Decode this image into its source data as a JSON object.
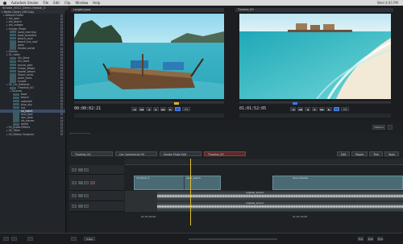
{
  "menubar": {
    "items": [
      "Autodesk Smoke",
      "File",
      "Edit",
      "Clip",
      "Window",
      "Help"
    ],
    "clock": "Wed 4:05 PM"
  },
  "window": {
    "title": "Smoke_2012_Demo_Hawaii_2"
  },
  "sidebar": {
    "header": "Media Library (Off Dup)",
    "items": [
      {
        "label": "Default Folder",
        "indent": 1,
        "kind": "folder"
      },
      {
        "label": "vid_spec",
        "indent": 2,
        "kind": "folder"
      },
      {
        "label": "vid_beach",
        "indent": 2,
        "kind": "folder"
      },
      {
        "label": "vid_collage",
        "indent": 2,
        "kind": "folder"
      },
      {
        "label": "Smoke_Photo",
        "indent": 2,
        "kind": "folder"
      },
      {
        "label": "sand_morning",
        "indent": 3,
        "kind": "clip"
      },
      {
        "label": "boat_shoreline",
        "indent": 3,
        "kind": "clip"
      },
      {
        "label": "beach_cove",
        "indent": 3,
        "kind": "clip"
      },
      {
        "label": "beach_hut_roof",
        "indent": 3,
        "kind": "clip"
      },
      {
        "label": "palm",
        "indent": 3,
        "kind": "clip"
      },
      {
        "label": "Smoke_aerial",
        "indent": 3,
        "kind": "clip"
      },
      {
        "label": "Scenes",
        "indent": 2,
        "kind": "folder"
      },
      {
        "label": "01_Hotel",
        "indent": 2,
        "kind": "folder"
      },
      {
        "label": "Sin_Desk",
        "indent": 3,
        "kind": "clip"
      },
      {
        "label": "Sin_Dock",
        "indent": 3,
        "kind": "clip"
      },
      {
        "label": "tunnel_side",
        "indent": 3,
        "kind": "clip"
      },
      {
        "label": "Ocean_Water",
        "indent": 3,
        "kind": "clip"
      },
      {
        "label": "hawaii_beach",
        "indent": 3,
        "kind": "clip"
      },
      {
        "label": "Shore_rocks",
        "indent": 3,
        "kind": "clip"
      },
      {
        "label": "palm_trees",
        "indent": 3,
        "kind": "clip"
      },
      {
        "label": "sunset",
        "indent": 3,
        "kind": "clip"
      },
      {
        "label": "02_Car_Editorial",
        "indent": 2,
        "kind": "folder"
      },
      {
        "label": "Timeline_VO",
        "indent": 3,
        "kind": "clip"
      },
      {
        "label": "Sources",
        "indent": 3,
        "kind": "folder"
      },
      {
        "label": "boat",
        "indent": 4,
        "kind": "clip"
      },
      {
        "label": "beach",
        "indent": 4,
        "kind": "clip"
      },
      {
        "label": "waterfall",
        "indent": 4,
        "kind": "clip"
      },
      {
        "label": "blue_sky",
        "indent": 4,
        "kind": "clip"
      },
      {
        "label": "hut",
        "indent": 4,
        "kind": "clip"
      },
      {
        "label": "vo_take3",
        "indent": 4,
        "kind": "clip",
        "selected": true
      },
      {
        "label": "mus_bed",
        "indent": 4,
        "kind": "clip"
      },
      {
        "label": "rain_dark",
        "indent": 4,
        "kind": "clip"
      },
      {
        "label": "sfx_waves",
        "indent": 4,
        "kind": "clip"
      },
      {
        "label": "aerial",
        "indent": 4,
        "kind": "clip"
      },
      {
        "label": "03_Audio Effects",
        "indent": 2,
        "kind": "folder"
      },
      {
        "label": "04_Titles",
        "indent": 2,
        "kind": "folder"
      },
      {
        "label": "05_Motion Graphics",
        "indent": 2,
        "kind": "folder"
      }
    ]
  },
  "viewers": {
    "left": {
      "tab": "Longtail_boat",
      "timecode": "00:00:02:21",
      "controls": [
        "|◀",
        "◀◀",
        "◀",
        "▶",
        "▶▶",
        "▶|"
      ],
      "zoom": "Fit"
    },
    "right": {
      "tab": "Timeline_VO",
      "timecode": "01:01:52:05",
      "controls": [
        "|◀",
        "◀◀",
        "◀",
        "▶",
        "▶▶",
        "▶|"
      ],
      "zoom": "Fit"
    },
    "options_label": "Options"
  },
  "timeline": {
    "mode_label": "Source",
    "mode2_label": "Record Mode",
    "sequence_tabs": [
      "Timeline_VO",
      "Car Commercial VO",
      "Smoke Photo Edit",
      "Timeline_VO"
    ],
    "right_buttons": [
      "Edit",
      "Ripple",
      "Trim",
      "Tools"
    ],
    "clip_labels": [
      "Vid_Boat_5",
      "sand_beach",
      "Sand_Hawaii"
    ],
    "audio_labels": [
      "original_sound",
      "original_sound"
    ],
    "ruler_ticks": [
      "01:01:00:00",
      "01:01:30:00"
    ],
    "colors": {
      "playhead": "#e2c227",
      "clip": "#4a6b73",
      "active_tab": "#5a2a2a",
      "accent": "#2a63c7"
    }
  },
  "bottombar": {
    "zoom_label": "Scale",
    "items": [
      "Full",
      "Edit",
      "Trim"
    ]
  }
}
